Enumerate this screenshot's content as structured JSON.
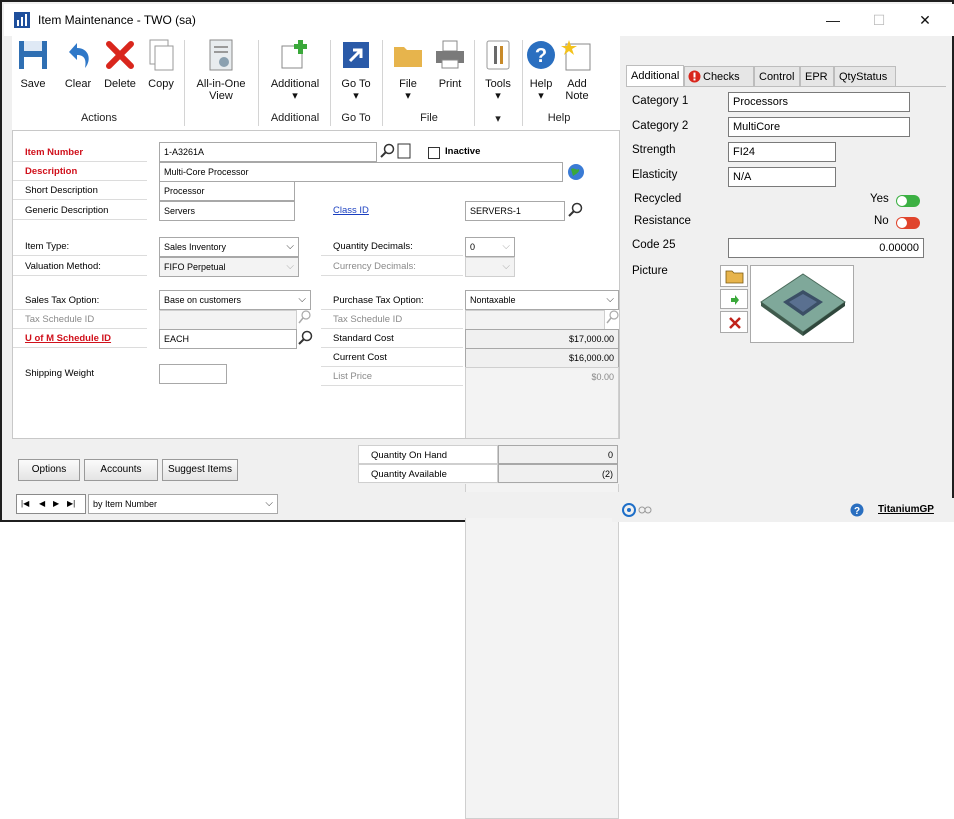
{
  "window": {
    "title": "Item Maintenance  -  TWO (sa)",
    "minimize": "—",
    "maximize": "☐",
    "close": "✕"
  },
  "ribbon": {
    "save": "Save",
    "clear": "Clear",
    "delete": "Delete",
    "copy": "Copy",
    "all_in_one_1": "All-in-One",
    "all_in_one_2": "View",
    "additional": "Additional",
    "goto": "Go To",
    "file": "File",
    "print": "Print",
    "tools": "Tools",
    "help": "Help",
    "add_note_1": "Add",
    "add_note_2": "Note",
    "group_actions": "Actions",
    "group_additional": "Additional",
    "group_goto": "Go To",
    "group_file": "File",
    "group_help": "Help",
    "dropdown_arrow": "▾"
  },
  "form": {
    "item_number_label": "Item Number",
    "item_number": "1-A3261A",
    "inactive_label": "Inactive",
    "description_label": "Description",
    "description": "Multi-Core Processor",
    "short_desc_label": "Short Description",
    "short_desc": "Processor",
    "generic_desc_label": "Generic Description",
    "generic_desc": "Servers",
    "class_id_label": "Class ID",
    "class_id": "SERVERS-1",
    "item_type_label": "Item Type:",
    "item_type": "Sales Inventory",
    "valuation_label": "Valuation Method:",
    "valuation": "FIFO Perpetual",
    "qty_decimals_label": "Quantity Decimals:",
    "qty_decimals": "0",
    "cur_decimals_label": "Currency Decimals:",
    "cur_decimals": "",
    "sales_tax_label": "Sales Tax Option:",
    "sales_tax": "Base on customers",
    "sales_sched_label": "Tax Schedule ID",
    "sales_sched": "",
    "purchase_tax_label": "Purchase Tax Option:",
    "purchase_tax": "Nontaxable",
    "purchase_sched_label": "Tax Schedule ID",
    "purchase_sched": "",
    "uom_label": "U of M Schedule ID",
    "uom": "EACH",
    "std_cost_label": "Standard Cost",
    "std_cost": "$17,000.00",
    "cur_cost_label": "Current Cost",
    "cur_cost": "$16,000.00",
    "list_price_label": "List Price",
    "list_price": "$0.00",
    "ship_weight_label": "Shipping Weight",
    "ship_weight": ""
  },
  "bottom": {
    "options": "Options",
    "accounts": "Accounts",
    "suggest": "Suggest Items",
    "qty_hand_label": "Quantity On Hand",
    "qty_hand": "0",
    "qty_avail_label": "Quantity Available",
    "qty_avail": "(2)"
  },
  "nav": {
    "first": "|◀",
    "prev": "◀",
    "next": "▶",
    "last": "▶|",
    "sort": "by Item Number"
  },
  "right": {
    "tabs": {
      "additional": "Additional",
      "checks": "Checks",
      "control": "Control",
      "epr": "EPR",
      "qtystatus": "QtyStatus"
    },
    "category1_label": "Category 1",
    "category1": "Processors",
    "category2_label": "Category 2",
    "category2": "MultiCore",
    "strength_label": "Strength",
    "strength": "FI24",
    "elasticity_label": "Elasticity",
    "elasticity": "N/A",
    "recycled_label": "Recycled",
    "recycled": "Yes",
    "resistance_label": "Resistance",
    "resistance": "No",
    "code25_label": "Code 25",
    "code25": "0.00000",
    "picture_label": "Picture"
  },
  "status": {
    "brand": "TitaniumGP"
  },
  "colors": {
    "toggle_on": "#3cb043",
    "toggle_off": "#e0442c",
    "required_red": "#d0101b",
    "link_blue": "#1a3fc0"
  }
}
